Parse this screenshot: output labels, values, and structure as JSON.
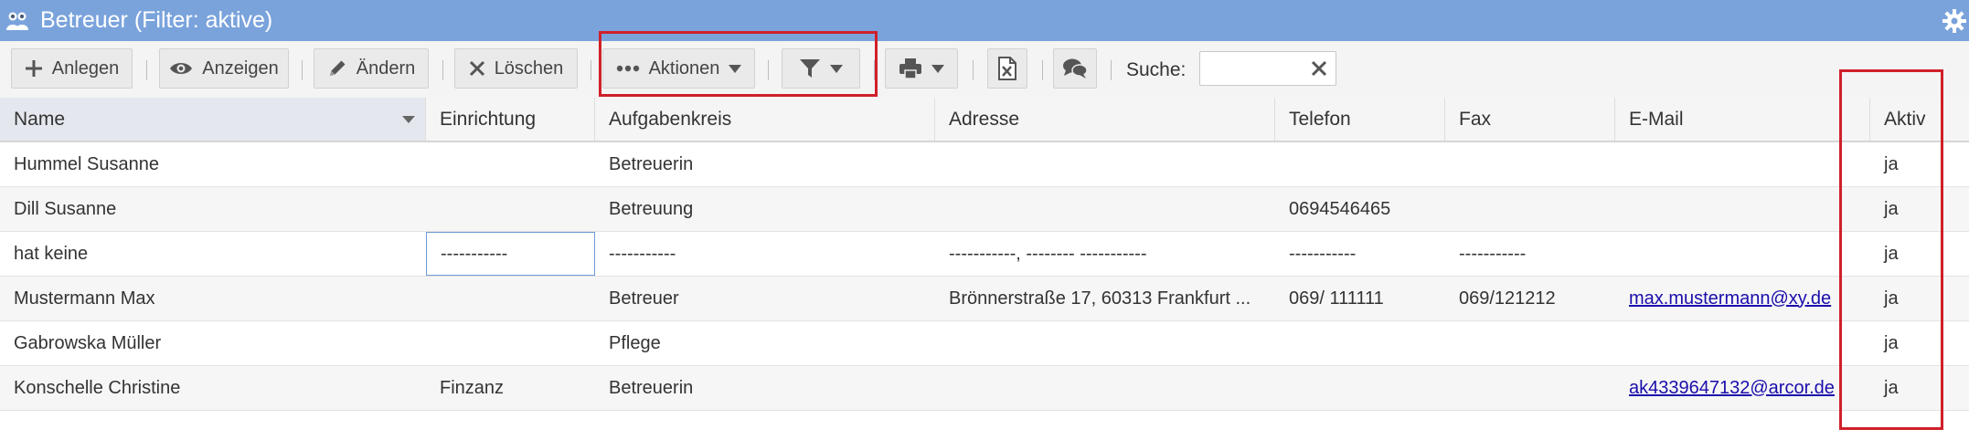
{
  "window": {
    "title": "Betreuer (Filter: aktive)"
  },
  "toolbar": {
    "add_label": "Anlegen",
    "view_label": "Anzeigen",
    "edit_label": "Ändern",
    "delete_label": "Löschen",
    "actions_label": "Aktionen",
    "search_label": "Suche:",
    "search_value": ""
  },
  "columns": [
    "Name",
    "Einrichtung",
    "Aufgabenkreis",
    "Adresse",
    "Telefon",
    "Fax",
    "E-Mail",
    "Aktiv"
  ],
  "rows": [
    {
      "name": "Hummel Susanne",
      "einrichtung": "",
      "aufgabenkreis": "Betreuerin",
      "adresse": "",
      "telefon": "",
      "fax": "",
      "email": "",
      "aktiv": "ja"
    },
    {
      "name": "Dill Susanne",
      "einrichtung": "",
      "aufgabenkreis": "Betreuung",
      "adresse": "",
      "telefon": "0694546465",
      "fax": "",
      "email": "",
      "aktiv": "ja"
    },
    {
      "name": "hat keine",
      "einrichtung": "-----------",
      "aufgabenkreis": "-----------",
      "adresse": "-----------, -------- -----------",
      "telefon": "-----------",
      "fax": "-----------",
      "email": "",
      "aktiv": "ja"
    },
    {
      "name": "Mustermann Max",
      "einrichtung": "",
      "aufgabenkreis": "Betreuer",
      "adresse": "Brönnerstraße 17, 60313 Frankfurt ...",
      "telefon": "069/ 111111",
      "fax": "069/121212",
      "email": "max.mustermann@xy.de",
      "aktiv": "ja"
    },
    {
      "name": "Gabrowska Müller",
      "einrichtung": "",
      "aufgabenkreis": "Pflege",
      "adresse": "",
      "telefon": "",
      "fax": "",
      "email": "",
      "aktiv": "ja"
    },
    {
      "name": "Konschelle Christine",
      "einrichtung": "Finzanz",
      "aufgabenkreis": "Betreuerin",
      "adresse": "",
      "telefon": "",
      "fax": "",
      "email": "ak4339647132@arcor.de",
      "aktiv": "ja"
    }
  ],
  "icons": {
    "title": "users-icon",
    "settings": "gear-icon",
    "add": "plus-icon",
    "view": "eye-icon",
    "edit": "pencil-icon",
    "delete": "x-icon",
    "actions": "dots-icon",
    "filter": "filter-icon",
    "print": "printer-icon",
    "export": "excel-icon",
    "comments": "comments-icon",
    "clear": "clear-icon",
    "sort": "caret-down-icon"
  },
  "colors": {
    "titlebar": "#7aa3dc",
    "highlight": "#d0202a",
    "link": "#1a0dab",
    "focus_border": "#6e9bd6"
  }
}
